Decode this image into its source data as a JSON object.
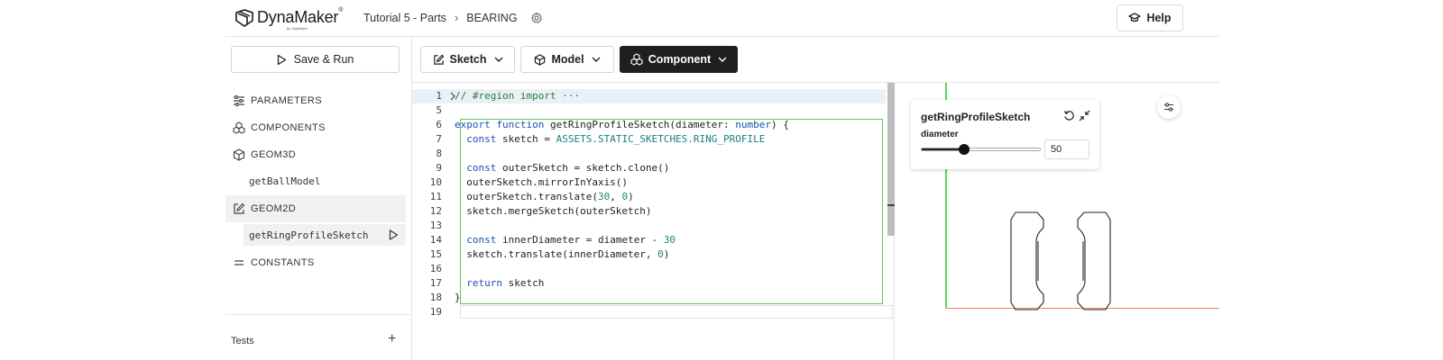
{
  "header": {
    "brand": "DynaMaker",
    "brand_sub": "by SkyMaker",
    "breadcrumbs": [
      "Tutorial 5 - Parts",
      "BEARING"
    ],
    "help_label": "Help"
  },
  "sidebar": {
    "save_run_label": "Save & Run",
    "items": [
      {
        "label": "PARAMETERS",
        "icon": "sliders-icon"
      },
      {
        "label": "COMPONENTS",
        "icon": "components-icon"
      },
      {
        "label": "GEOM3D",
        "icon": "cube-icon"
      },
      {
        "label": "getBallModel"
      },
      {
        "label": "GEOM2D",
        "icon": "edit-icon"
      },
      {
        "label": "getRingProfileSketch"
      },
      {
        "label": "CONSTANTS",
        "icon": "equals-icon"
      }
    ],
    "tests_label": "Tests",
    "tests_add": "+"
  },
  "toolbar": {
    "sketch_label": "Sketch",
    "model_label": "Model",
    "component_label": "Component"
  },
  "editor": {
    "lines": [
      {
        "n": "1",
        "tokens": [
          [
            "cmt",
            "// #region import"
          ],
          [
            "punc",
            " ···"
          ]
        ],
        "folded": true
      },
      {
        "n": "5",
        "tokens": []
      },
      {
        "n": "6",
        "tokens": [
          [
            "kw",
            "export"
          ],
          [
            "",
            " "
          ],
          [
            "kw",
            "function"
          ],
          [
            "",
            " getRingProfileSketch(diameter: "
          ],
          [
            "kw",
            "number"
          ],
          [
            "",
            ") {"
          ]
        ]
      },
      {
        "n": "7",
        "tokens": [
          [
            "",
            "  "
          ],
          [
            "kw",
            "const"
          ],
          [
            "",
            " sketch = "
          ],
          [
            "con",
            "ASSETS.STATIC_SKETCHES.RING_PROFILE"
          ]
        ]
      },
      {
        "n": "8",
        "tokens": []
      },
      {
        "n": "9",
        "tokens": [
          [
            "",
            "  "
          ],
          [
            "kw",
            "const"
          ],
          [
            "",
            " outerSketch = sketch.clone()"
          ]
        ]
      },
      {
        "n": "10",
        "tokens": [
          [
            "",
            "  outerSketch.mirrorInYaxis()"
          ]
        ]
      },
      {
        "n": "11",
        "tokens": [
          [
            "",
            "  outerSketch.translate("
          ],
          [
            "num",
            "30"
          ],
          [
            "",
            ", "
          ],
          [
            "num",
            "0"
          ],
          [
            "",
            ")"
          ]
        ]
      },
      {
        "n": "12",
        "tokens": [
          [
            "",
            "  sketch.mergeSketch(outerSketch)"
          ]
        ]
      },
      {
        "n": "13",
        "tokens": []
      },
      {
        "n": "14",
        "tokens": [
          [
            "",
            "  "
          ],
          [
            "kw",
            "const"
          ],
          [
            "",
            " innerDiameter = diameter - "
          ],
          [
            "num",
            "30"
          ]
        ]
      },
      {
        "n": "15",
        "tokens": [
          [
            "",
            "  sketch.translate(innerDiameter, "
          ],
          [
            "num",
            "0"
          ],
          [
            "",
            ")"
          ]
        ]
      },
      {
        "n": "16",
        "tokens": []
      },
      {
        "n": "17",
        "tokens": [
          [
            "",
            "  "
          ],
          [
            "kw",
            "return"
          ],
          [
            "",
            " sketch"
          ]
        ]
      },
      {
        "n": "18",
        "tokens": [
          [
            "",
            "}"
          ]
        ]
      },
      {
        "n": "19",
        "tokens": []
      }
    ]
  },
  "viewer": {
    "card_title": "getRingProfileSketch",
    "param_label": "diameter",
    "param_value": "50",
    "slider_level": 0.36,
    "colors": {
      "y_axis": "#56d856",
      "x_axis": "#f07f6a"
    }
  }
}
